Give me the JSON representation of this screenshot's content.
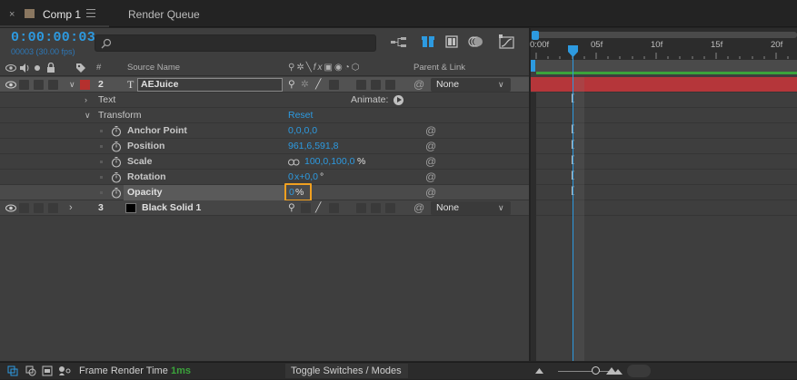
{
  "tabs": {
    "comp": "Comp 1",
    "render": "Render Queue"
  },
  "timecode": "0:00:00:03",
  "fps": "00003 (30.00 fps)",
  "search": {
    "placeholder": ""
  },
  "columns": {
    "num": "#",
    "source": "Source Name",
    "parent": "Parent & Link"
  },
  "ruler": {
    "ticks": [
      "0:00f",
      "05f",
      "10f",
      "15f",
      "20f"
    ]
  },
  "layers": [
    {
      "index": "2",
      "type": "T",
      "name": "AEJuice",
      "parent": "None",
      "color": "#b5302e"
    },
    {
      "index": "3",
      "name": "Black Solid 1",
      "parent": "None",
      "color": "#000000"
    }
  ],
  "text_group": {
    "label": "Text",
    "animate": "Animate:"
  },
  "transform": {
    "label": "Transform",
    "reset": "Reset"
  },
  "properties": [
    {
      "name": "Anchor Point",
      "value": "0,0,0,0"
    },
    {
      "name": "Position",
      "value": "961,6,591,8"
    },
    {
      "name": "Scale",
      "value": "100,0,100,0",
      "unit": "%"
    },
    {
      "name": "Rotation",
      "value": "0",
      "value2": "x+0,0",
      "unit": "°"
    },
    {
      "name": "Opacity",
      "value": "0",
      "unit": "%"
    }
  ],
  "status": {
    "frame_render_label": "Frame Render Time",
    "frame_render_value": "1ms",
    "toggle": "Toggle Switches / Modes"
  },
  "colors": {
    "accent": "#2d9ae0",
    "highlight": "#f0a020",
    "layer_bar": "#b5363a",
    "green_bar": "#3ba33b"
  }
}
